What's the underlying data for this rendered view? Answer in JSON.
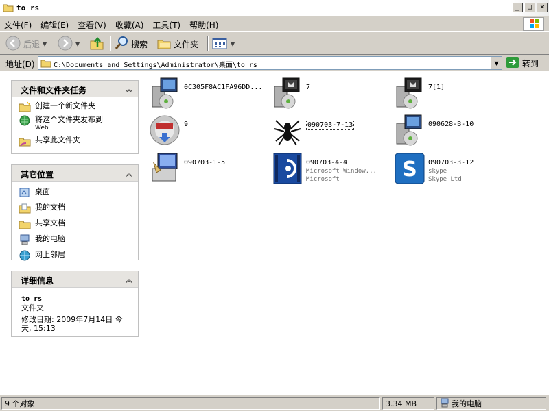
{
  "window": {
    "title": "to rs",
    "buttons": {
      "minimize": "_",
      "maximize": "□",
      "close": "×"
    }
  },
  "menu": [
    "文件(F)",
    "编辑(E)",
    "查看(V)",
    "收藏(A)",
    "工具(T)",
    "帮助(H)"
  ],
  "toolbar": {
    "back_label": "后退",
    "search_label": "搜索",
    "folders_label": "文件夹"
  },
  "address": {
    "label": "地址(D)",
    "path": "C:\\Documents and Settings\\Administrator\\桌面\\to rs",
    "go_label": "转到"
  },
  "panels": {
    "tasks": {
      "title": "文件和文件夹任务",
      "items": [
        {
          "label": "创建一个新文件夹",
          "icon": "new-folder-icon"
        },
        {
          "label": "将这个文件夹发布到",
          "sublabel": "Web",
          "icon": "publish-web-icon"
        },
        {
          "label": "共享此文件夹",
          "icon": "share-folder-icon"
        }
      ]
    },
    "places": {
      "title": "其它位置",
      "items": [
        {
          "label": "桌面",
          "icon": "desktop-icon"
        },
        {
          "label": "我的文档",
          "icon": "my-documents-icon"
        },
        {
          "label": "共享文档",
          "icon": "shared-documents-icon"
        },
        {
          "label": "我的电脑",
          "icon": "my-computer-icon"
        },
        {
          "label": "网上邻居",
          "icon": "network-icon"
        }
      ]
    },
    "details": {
      "title": "详细信息",
      "name": "to rs",
      "type": "文件夹",
      "modified": "修改日期: 2009年7月14日 今天, 15:13"
    }
  },
  "files": [
    {
      "name": "0C305F8AC1FA96DD...",
      "icon": "installer-icon"
    },
    {
      "name": "7",
      "icon": "installer-icon"
    },
    {
      "name": "7[1]",
      "icon": "installer-icon"
    },
    {
      "name": "9",
      "icon": "nsis-installer-icon"
    },
    {
      "name": "090703-7-13",
      "icon": "spider-icon"
    },
    {
      "name": "090628-B-10",
      "icon": "installer-icon"
    },
    {
      "name": "090703-1-5",
      "icon": "setup-icon"
    },
    {
      "name": "090703-4-4",
      "desc": "Microsoft Window...",
      "company": "Microsoft",
      "icon": "media-player-icon"
    },
    {
      "name": "090703-3-12",
      "desc": "skype",
      "company": "Skype Ltd",
      "icon": "skype-icon"
    }
  ],
  "status": {
    "count": "9 个对象",
    "size": "3.34 MB",
    "location": "我的电脑"
  },
  "colors": {
    "chrome": "#d4d0c8",
    "panel_head": "#e6e4e0",
    "address_border": "#7f9db9",
    "go_arrow": "#2e9b3a",
    "skype_blue": "#1f6fc1"
  }
}
